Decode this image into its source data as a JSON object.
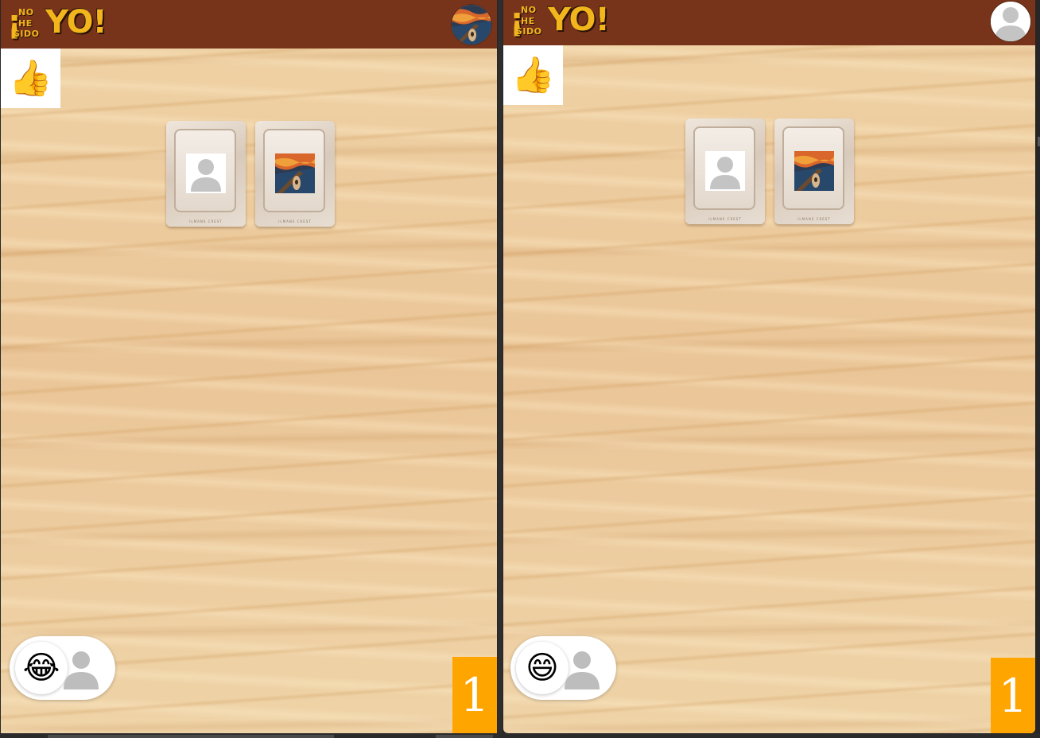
{
  "colors": {
    "header": "#77341b",
    "counter_bg": "#ffa500",
    "logo": "#f2b51c",
    "table_wood": "#eccb9b"
  },
  "logo": {
    "exclamation": "¡",
    "line1": "NO",
    "line2": "HE",
    "line3": "SIDO",
    "big": "YO!"
  },
  "left_view": {
    "avatar_icon": "scream-painting-avatar",
    "reaction_button_icon": "thumbs-up-emoji",
    "reaction_button_glyph": "👍",
    "cards": [
      {
        "icon": "person-placeholder-icon",
        "caption": "ILMANS CREST"
      },
      {
        "icon": "scream-painting-thumbnail",
        "caption": "ILMANS CREST"
      }
    ],
    "emoji_glyph": "😂",
    "emoji_icon": "laughing-tears-emoji",
    "pill_person_icon": "person-placeholder-icon",
    "counter": "1"
  },
  "right_view": {
    "avatar_icon": "person-placeholder-icon",
    "reaction_button_icon": "thumbs-up-emoji",
    "reaction_button_glyph": "👍",
    "cards": [
      {
        "icon": "person-placeholder-icon",
        "caption": "ILMANS CREST"
      },
      {
        "icon": "scream-painting-thumbnail",
        "caption": "ILMANS CREST"
      }
    ],
    "emoji_glyph": "😄",
    "emoji_icon": "grinning-face-emoji",
    "pill_person_icon": "person-placeholder-icon",
    "counter": "1"
  }
}
